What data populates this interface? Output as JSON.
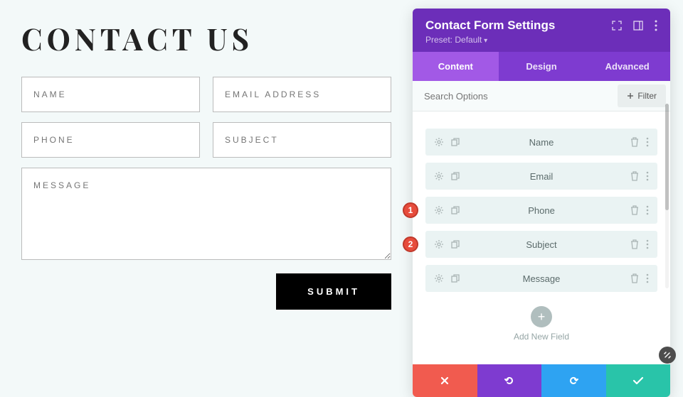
{
  "form": {
    "title": "CONTACT US",
    "fields": {
      "name": "NAME",
      "email": "EMAIL ADDRESS",
      "phone": "PHONE",
      "subject": "SUBJECT",
      "message": "MESSAGE"
    },
    "submit": "SUBMIT"
  },
  "panel": {
    "title": "Contact Form Settings",
    "preset": "Preset: Default",
    "tabs": {
      "content": "Content",
      "design": "Design",
      "advanced": "Advanced"
    },
    "search_placeholder": "Search Options",
    "filter_label": "Filter",
    "fields": [
      {
        "label": "Name"
      },
      {
        "label": "Email"
      },
      {
        "label": "Phone",
        "badge": "1"
      },
      {
        "label": "Subject",
        "badge": "2"
      },
      {
        "label": "Message"
      }
    ],
    "add_new_label": "Add New Field"
  }
}
